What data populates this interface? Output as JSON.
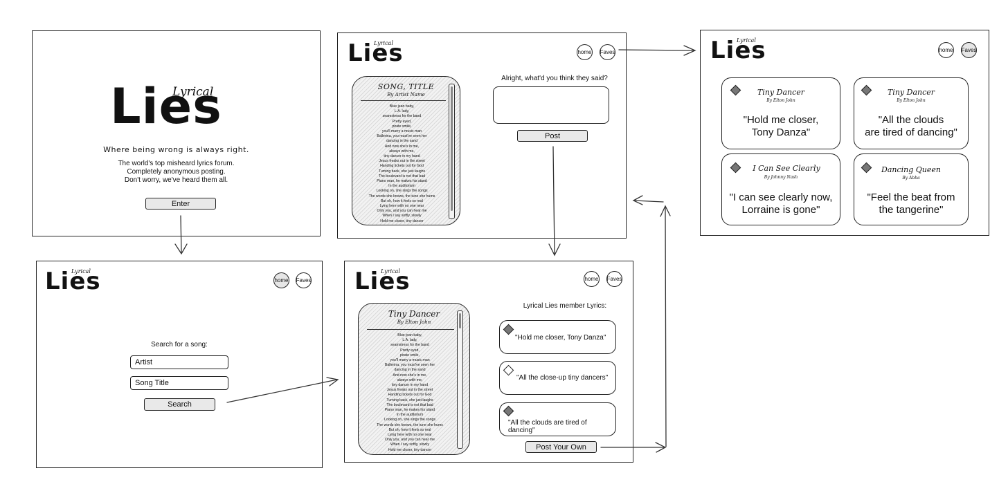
{
  "logo": {
    "lyrical": "Lyrical",
    "lies": "Lies"
  },
  "landing": {
    "tagline": "Where being wrong is always right.",
    "desc": [
      "The world's top misheard lyrics forum.",
      "Completely anonymous posting.",
      "Don't worry, we've heard them all."
    ],
    "enter_label": "Enter"
  },
  "nav": {
    "home": "home",
    "faves": "Faves"
  },
  "search": {
    "heading": "Search for a song:",
    "artist_value": "Artist",
    "title_value": "Song Title",
    "search_label": "Search"
  },
  "post": {
    "song_title": "SONG, TITLE",
    "song_by": "By Artist Name",
    "prompt": "Alright, what'd you think they said?",
    "post_label": "Post"
  },
  "song_view": {
    "song_title": "Tiny Dancer",
    "song_by": "By Elton John",
    "heading": "Lyrical Lies member Lyrics:",
    "member_lyrics": [
      {
        "text": "\"Hold me closer, Tony Danza\"",
        "favorited": true
      },
      {
        "text": "\"All the close-up tiny dancers\"",
        "favorited": false
      },
      {
        "text": "\"All the clouds are tired of dancing\"",
        "favorited": true
      }
    ],
    "post_own_label": "Post Your Own"
  },
  "lyrics_full": [
    "Blue jean baby,",
    "L.A. lady,",
    "seamstress for the band",
    "Pretty eyed,",
    "pirate smile,",
    "you'll marry a music man",
    "Ballerina, you must've seen her",
    "dancing in the sand",
    "And now she's in me,",
    "always with me,",
    "tiny dancer in my hand",
    "Jesus freaks out in the street",
    "Handing tickets out for God",
    "Turning back, she just laughs",
    "The boulevard is not that bad",
    "Piano man, he makes his stand",
    "In the auditorium",
    "Looking on, she sings the songs",
    "The words she knows, the tune she hums",
    "But oh, how it feels so real",
    "Lying here with no one near",
    "Only you, and you can hear me",
    "When I say softly, slowly",
    "Hold me closer, tiny dancer"
  ],
  "faves": [
    {
      "title": "Tiny Dancer",
      "by": "By Elton John",
      "quote": [
        "\"Hold me closer,",
        "Tony Danza\""
      ]
    },
    {
      "title": "Tiny Dancer",
      "by": "By Elton John",
      "quote": [
        "\"All the clouds",
        "are tired of dancing\""
      ]
    },
    {
      "title": "I Can See Clearly",
      "by": "By Johnny Nash",
      "quote": [
        "\"I can see clearly now,",
        "Lorraine is gone\""
      ]
    },
    {
      "title": "Dancing Queen",
      "by": "By Abba",
      "quote": [
        "\"Feel the beat from",
        "the tangerine\""
      ]
    }
  ]
}
